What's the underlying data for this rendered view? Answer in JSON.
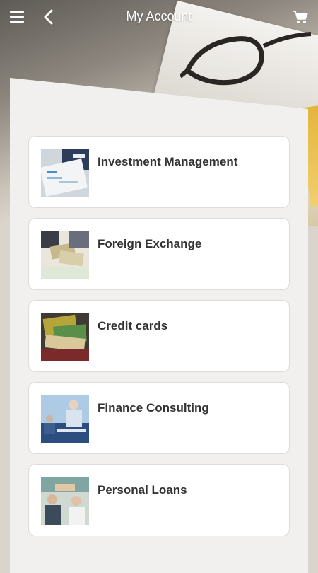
{
  "header": {
    "title": "My Account"
  },
  "items": [
    {
      "label": "Investment Management",
      "icon": "investment-documents-image"
    },
    {
      "label": "Foreign Exchange",
      "icon": "currency-exchange-image"
    },
    {
      "label": "Credit cards",
      "icon": "credit-cards-image"
    },
    {
      "label": "Finance Consulting",
      "icon": "consulting-meeting-image"
    },
    {
      "label": "Personal Loans",
      "icon": "loan-handshake-image"
    }
  ],
  "colors": {
    "card_background": "#ffffff",
    "panel_background": "#f1f0ee",
    "label_text": "#333333",
    "header_text": "#ffffff"
  }
}
